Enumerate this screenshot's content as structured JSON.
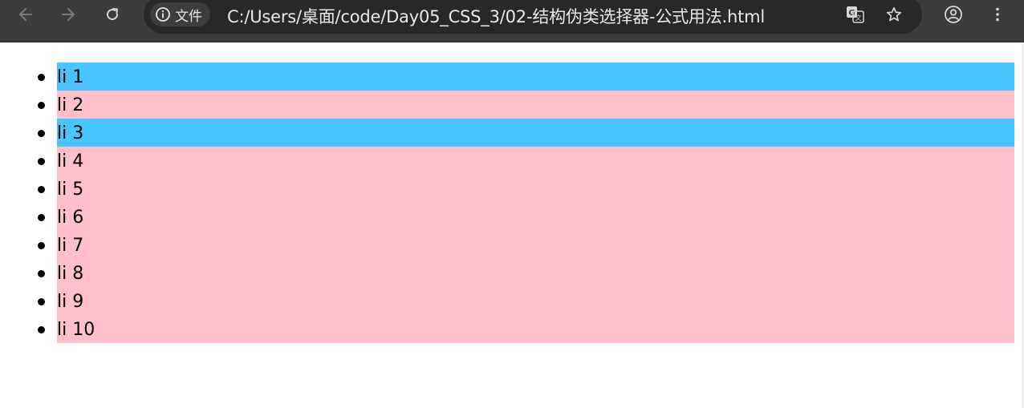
{
  "browser": {
    "site_info_label": "文件",
    "url": "C:/Users/桌面/code/Day05_CSS_3/02-结构伪类选择器-公式用法.html",
    "icons": {
      "back": "arrow-left-icon",
      "forward": "arrow-right-icon",
      "reload": "reload-icon",
      "site_info": "info-icon",
      "translate": "translate-icon",
      "bookmark": "star-icon",
      "profile": "account-icon",
      "menu": "kebab-menu-icon"
    },
    "colors": {
      "toolbar": "#3c3c3c",
      "omnibox": "#282828"
    }
  },
  "page": {
    "items": [
      {
        "label": "li 1",
        "bg": "#48c4ff"
      },
      {
        "label": "li 2",
        "bg": "#ffc0cb"
      },
      {
        "label": "li 3",
        "bg": "#48c4ff"
      },
      {
        "label": "li 4",
        "bg": "#ffc0cb"
      },
      {
        "label": "li 5",
        "bg": "#ffc0cb"
      },
      {
        "label": "li 6",
        "bg": "#ffc0cb"
      },
      {
        "label": "li 7",
        "bg": "#ffc0cb"
      },
      {
        "label": "li 8",
        "bg": "#ffc0cb"
      },
      {
        "label": "li 9",
        "bg": "#ffc0cb"
      },
      {
        "label": "li 10",
        "bg": "#ffc0cb"
      }
    ]
  }
}
